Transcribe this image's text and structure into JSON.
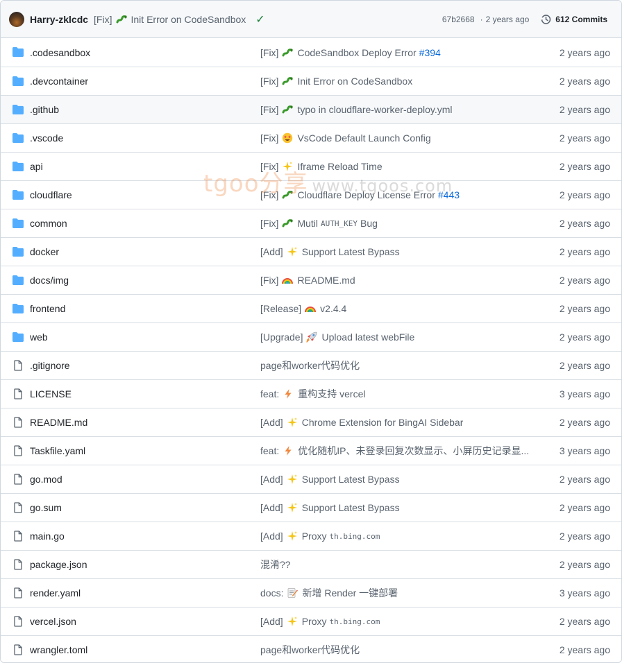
{
  "header": {
    "author": "Harry-zklcdc",
    "commit_prefix": "[Fix]",
    "commit_emoji": "bug-icon",
    "commit_text": "Init Error on CodeSandbox",
    "sha": "67b2668",
    "separator": "·",
    "age": "2 years ago",
    "commits_label": "612 Commits"
  },
  "watermark": {
    "brand": "tgoo分享",
    "url": "www.tgoos.com"
  },
  "files": [
    {
      "type": "dir",
      "name": ".codesandbox",
      "prefix": "[Fix]",
      "emoji": "bug-icon",
      "message": "CodeSandbox Deploy Error",
      "link": "#394",
      "time": "2 years ago"
    },
    {
      "type": "dir",
      "name": ".devcontainer",
      "prefix": "[Fix]",
      "emoji": "bug-icon",
      "message": "Init Error on CodeSandbox",
      "time": "2 years ago"
    },
    {
      "type": "dir",
      "name": ".github",
      "prefix": "[Fix]",
      "emoji": "bug-icon",
      "message": "typo in cloudflare-worker-deploy.yml",
      "time": "2 years ago"
    },
    {
      "type": "dir",
      "name": ".vscode",
      "prefix": "[Fix]",
      "emoji": "star-struck-icon",
      "message": "VsCode Default Launch Config",
      "time": "2 years ago"
    },
    {
      "type": "dir",
      "name": "api",
      "prefix": "[Fix]",
      "emoji": "sparkles-icon",
      "message": "Iframe Reload Time",
      "time": "2 years ago"
    },
    {
      "type": "dir",
      "name": "cloudflare",
      "prefix": "[Fix]",
      "emoji": "bug-icon",
      "message": "Cloudflare Deploy License Error",
      "link": "#443",
      "time": "2 years ago"
    },
    {
      "type": "dir",
      "name": "common",
      "prefix": "[Fix]",
      "emoji": "bug-icon",
      "message": "Mutil",
      "code": "AUTH_KEY",
      "after": "Bug",
      "time": "2 years ago"
    },
    {
      "type": "dir",
      "name": "docker",
      "prefix": "[Add]",
      "emoji": "sparkles-icon",
      "message": "Support Latest Bypass",
      "time": "2 years ago"
    },
    {
      "type": "dir",
      "name": "docs/img",
      "prefix": "[Fix]",
      "emoji": "rainbow-icon",
      "message": "README.md",
      "time": "2 years ago"
    },
    {
      "type": "dir",
      "name": "frontend",
      "prefix": "[Release]",
      "emoji": "rainbow-icon",
      "message": "v2.4.4",
      "time": "2 years ago"
    },
    {
      "type": "dir",
      "name": "web",
      "prefix": "[Upgrade]",
      "emoji": "rocket-icon",
      "message": "Upload latest webFile",
      "time": "2 years ago"
    },
    {
      "type": "file",
      "name": ".gitignore",
      "prefix": "",
      "emoji": "",
      "message": "page和worker代码优化",
      "time": "2 years ago"
    },
    {
      "type": "file",
      "name": "LICENSE",
      "prefix": "feat:",
      "emoji": "zap-icon",
      "message": "重构支持 vercel",
      "time": "3 years ago"
    },
    {
      "type": "file",
      "name": "README.md",
      "prefix": "[Add]",
      "emoji": "sparkles-icon",
      "message": "Chrome Extension for BingAI Sidebar",
      "time": "2 years ago"
    },
    {
      "type": "file",
      "name": "Taskfile.yaml",
      "prefix": "feat:",
      "emoji": "zap-icon",
      "message": "优化随机IP、未登录回复次数显示、小屏历史记录显...",
      "time": "3 years ago"
    },
    {
      "type": "file",
      "name": "go.mod",
      "prefix": "[Add]",
      "emoji": "sparkles-icon",
      "message": "Support Latest Bypass",
      "time": "2 years ago"
    },
    {
      "type": "file",
      "name": "go.sum",
      "prefix": "[Add]",
      "emoji": "sparkles-icon",
      "message": "Support Latest Bypass",
      "time": "2 years ago"
    },
    {
      "type": "file",
      "name": "main.go",
      "prefix": "[Add]",
      "emoji": "sparkles-icon",
      "message": "Proxy",
      "code": "th.bing.com",
      "time": "2 years ago"
    },
    {
      "type": "file",
      "name": "package.json",
      "prefix": "",
      "emoji": "",
      "message": "混淆??",
      "time": "2 years ago"
    },
    {
      "type": "file",
      "name": "render.yaml",
      "prefix": "docs:",
      "emoji": "memo-icon",
      "message": "新增 Render 一键部署",
      "time": "3 years ago"
    },
    {
      "type": "file",
      "name": "vercel.json",
      "prefix": "[Add]",
      "emoji": "sparkles-icon",
      "message": "Proxy",
      "code": "th.bing.com",
      "time": "2 years ago"
    },
    {
      "type": "file",
      "name": "wrangler.toml",
      "prefix": "",
      "emoji": "",
      "message": "page和worker代码优化",
      "time": "2 years ago"
    }
  ]
}
